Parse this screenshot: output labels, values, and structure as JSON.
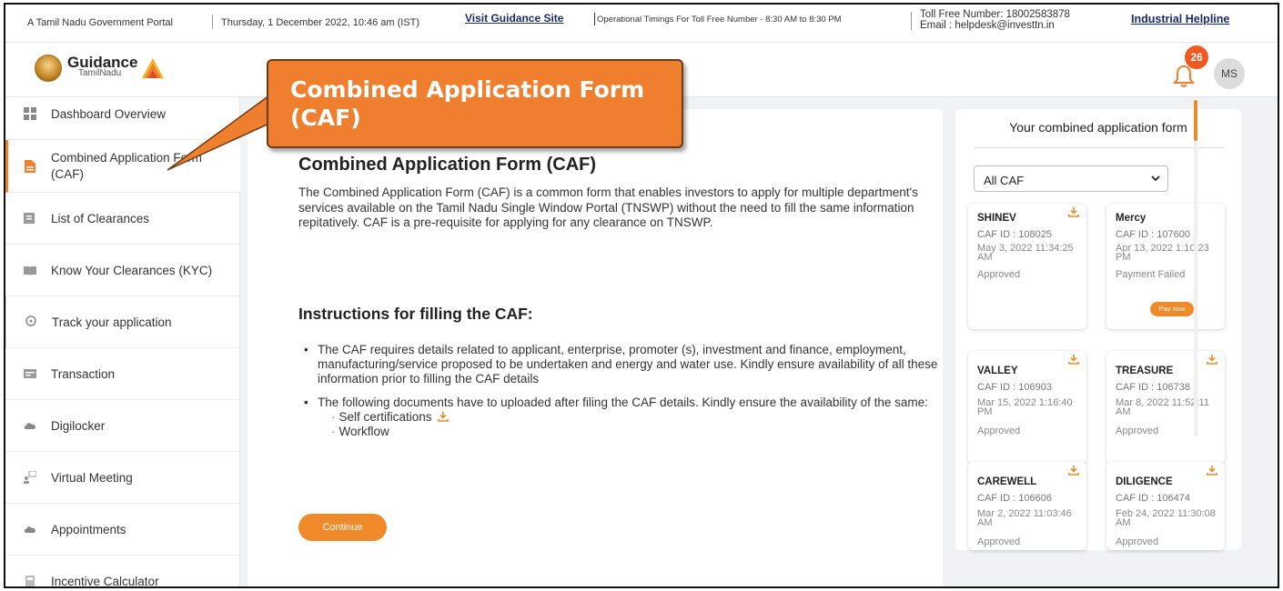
{
  "topbar": {
    "portal_name": "A Tamil Nadu Government Portal",
    "datetime": "Thursday, 1 December 2022, 10:46 am (IST)",
    "guidance_link": "Visit Guidance Site",
    "operational_timings": "Operational Timings For Toll Free Number - 8:30 AM to 8:30 PM",
    "toll_free": "Toll Free Number: 18002583878",
    "email": "Email : helpdesk@investtn.in",
    "helpline_link": "Industrial Helpline"
  },
  "header": {
    "logo_title": "Guidance",
    "logo_subtitle": "TamilNadu",
    "notification_count": "26",
    "avatar_initials": "MS"
  },
  "sidebar": {
    "items": [
      {
        "label": "Dashboard Overview",
        "icon": "dashboard-icon"
      },
      {
        "label": "Combined Application Form (CAF)",
        "icon": "document-icon"
      },
      {
        "label": "List of Clearances",
        "icon": "list-icon"
      },
      {
        "label": "Know Your Clearances (KYC)",
        "icon": "book-icon"
      },
      {
        "label": "Track your application",
        "icon": "location-pin-icon"
      },
      {
        "label": "Transaction",
        "icon": "transaction-icon"
      },
      {
        "label": "Digilocker",
        "icon": "cloud-icon"
      },
      {
        "label": "Virtual Meeting",
        "icon": "meeting-icon"
      },
      {
        "label": "Appointments",
        "icon": "cloud-icon"
      },
      {
        "label": "Incentive Calculator",
        "icon": "calculator-icon"
      }
    ]
  },
  "main": {
    "title": "Combined Application Form (CAF)",
    "intro": "The Combined Application Form (CAF) is a common form that enables investors to apply for multiple department's services available on the Tamil Nadu Single Window Portal (TNSWP) without the need to fill the same information repitatively. CAF is a pre-requisite for applying for any clearance on TNSWP.",
    "instructions_heading": "Instructions for filling the CAF:",
    "instructions": [
      "The CAF requires details related to applicant, enterprise, promoter (s), investment and finance, employment, manufacturing/service proposed to be undertaken and energy and water use. Kindly ensure availability of all these information prior to filling the CAF details",
      "The following documents have to uploaded after filing the CAF details. Kindly ensure the availability of the same:"
    ],
    "documents": [
      "Self certifications",
      "Workflow"
    ],
    "continue_label": "Continue"
  },
  "right_panel": {
    "title": "Your combined application form",
    "filter_selected": "All CAF",
    "cards": [
      {
        "name": "SHINEV",
        "caf_id": "CAF ID : 108025",
        "date": "May 3, 2022 11:34:25 AM",
        "status": "Approved"
      },
      {
        "name": "Mercy",
        "caf_id": "CAF ID : 107600",
        "date": "Apr 13, 2022 1:10:23 PM",
        "status": "Payment Failed",
        "action": "Pay now"
      },
      {
        "name": "VALLEY",
        "caf_id": "CAF ID : 106903",
        "date": "Mar 15, 2022 1:16:40 PM",
        "status": "Approved"
      },
      {
        "name": "TREASURE",
        "caf_id": "CAF ID : 106738",
        "date": "Mar 8, 2022 11:52:11 AM",
        "status": "Approved"
      },
      {
        "name": "CAREWELL",
        "caf_id": "CAF ID : 106606",
        "date": "Mar 2, 2022 11:03:46 AM",
        "status": "Approved"
      },
      {
        "name": "DILIGENCE",
        "caf_id": "CAF ID : 106474",
        "date": "Feb 24, 2022 11:30:08 AM",
        "status": "Approved"
      }
    ]
  },
  "callout": {
    "text": "Combined Application Form (CAF)"
  },
  "colors": {
    "accent": "#ef8a2a",
    "callout_fill": "#ef7f2e",
    "link_navy": "#1b2a6b",
    "badge": "#f05a22"
  }
}
